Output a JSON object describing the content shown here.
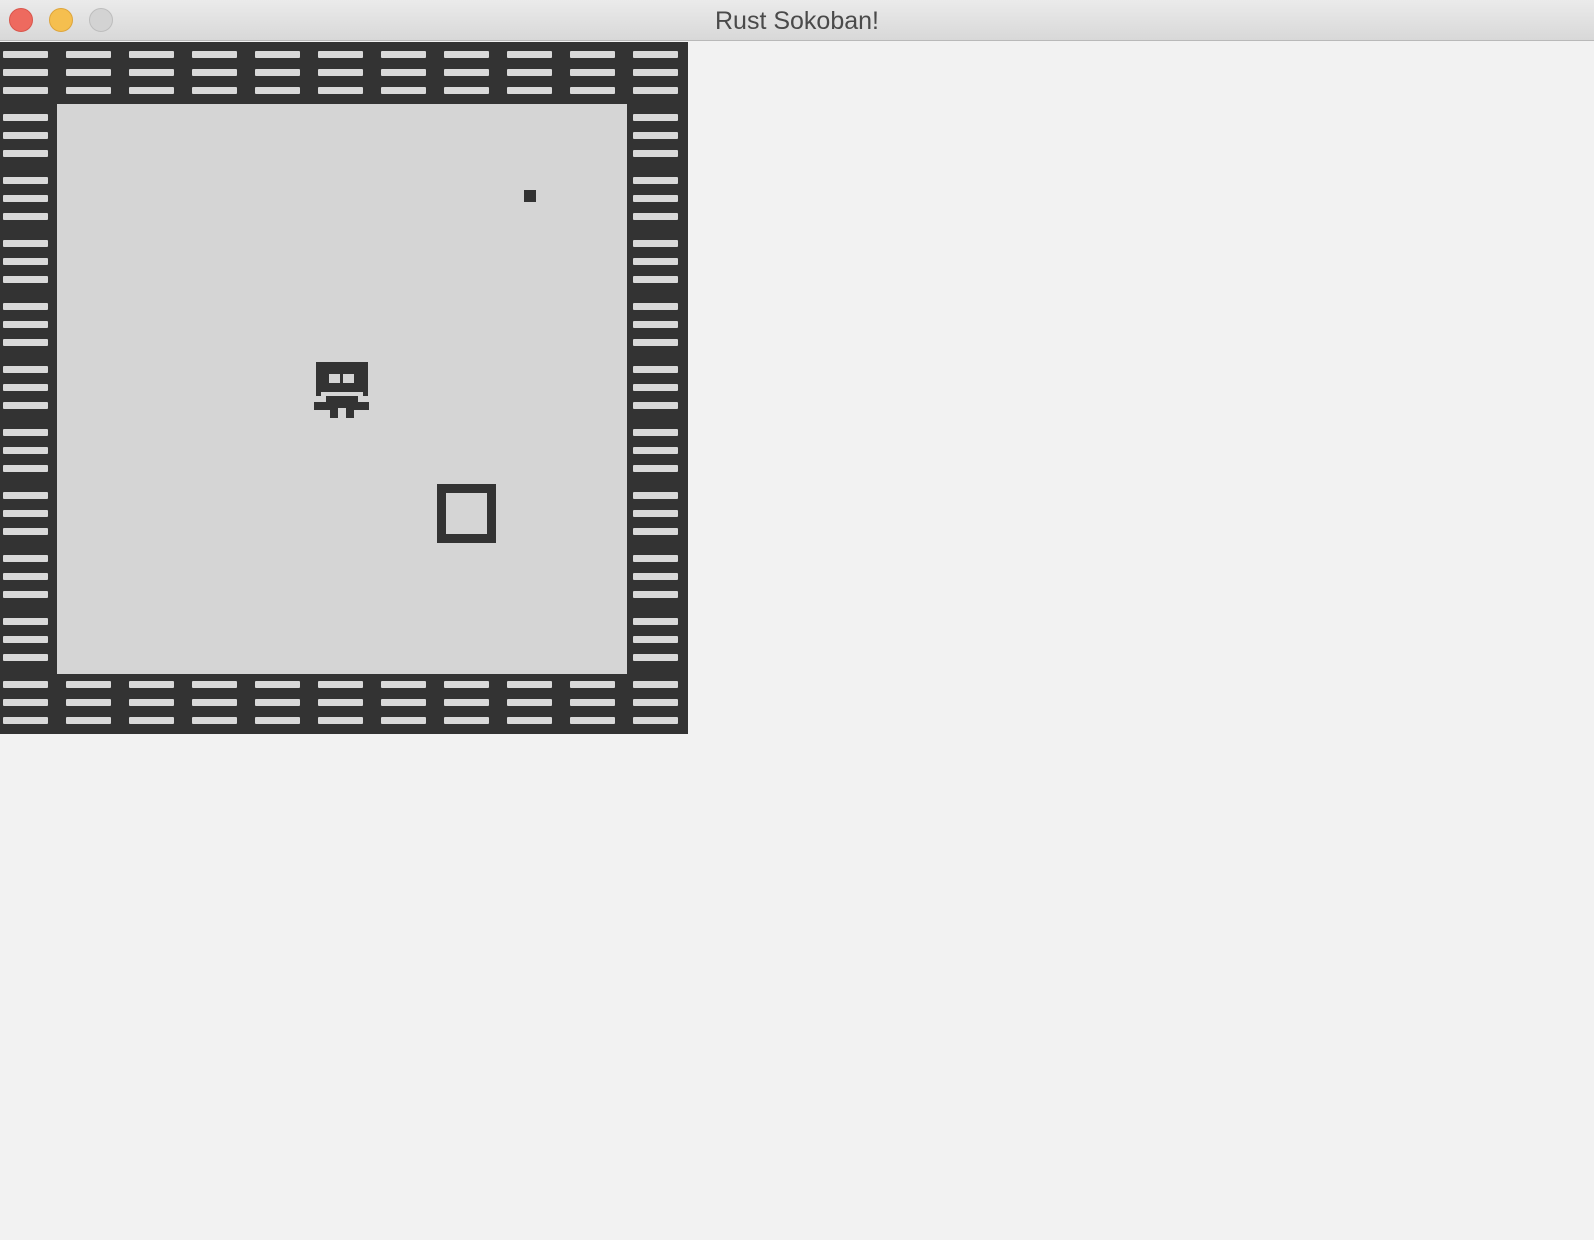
{
  "window": {
    "title": "Rust Sokoban!",
    "buttons": {
      "close": "close",
      "minimize": "minimize",
      "maximize": "maximize"
    }
  },
  "game": {
    "grid_columns": 11,
    "grid_rows": 11,
    "wall_color": "#333333",
    "floor_color": "#d5d5d5",
    "stripe_color": "#d9d9d9",
    "player": {
      "col": 5,
      "row": 5,
      "icon": "player-robot-icon"
    },
    "box": {
      "col": 7,
      "row": 7,
      "icon": "box-icon"
    },
    "spot": {
      "col": 8,
      "row": 2,
      "icon": "box-spot-icon"
    }
  }
}
